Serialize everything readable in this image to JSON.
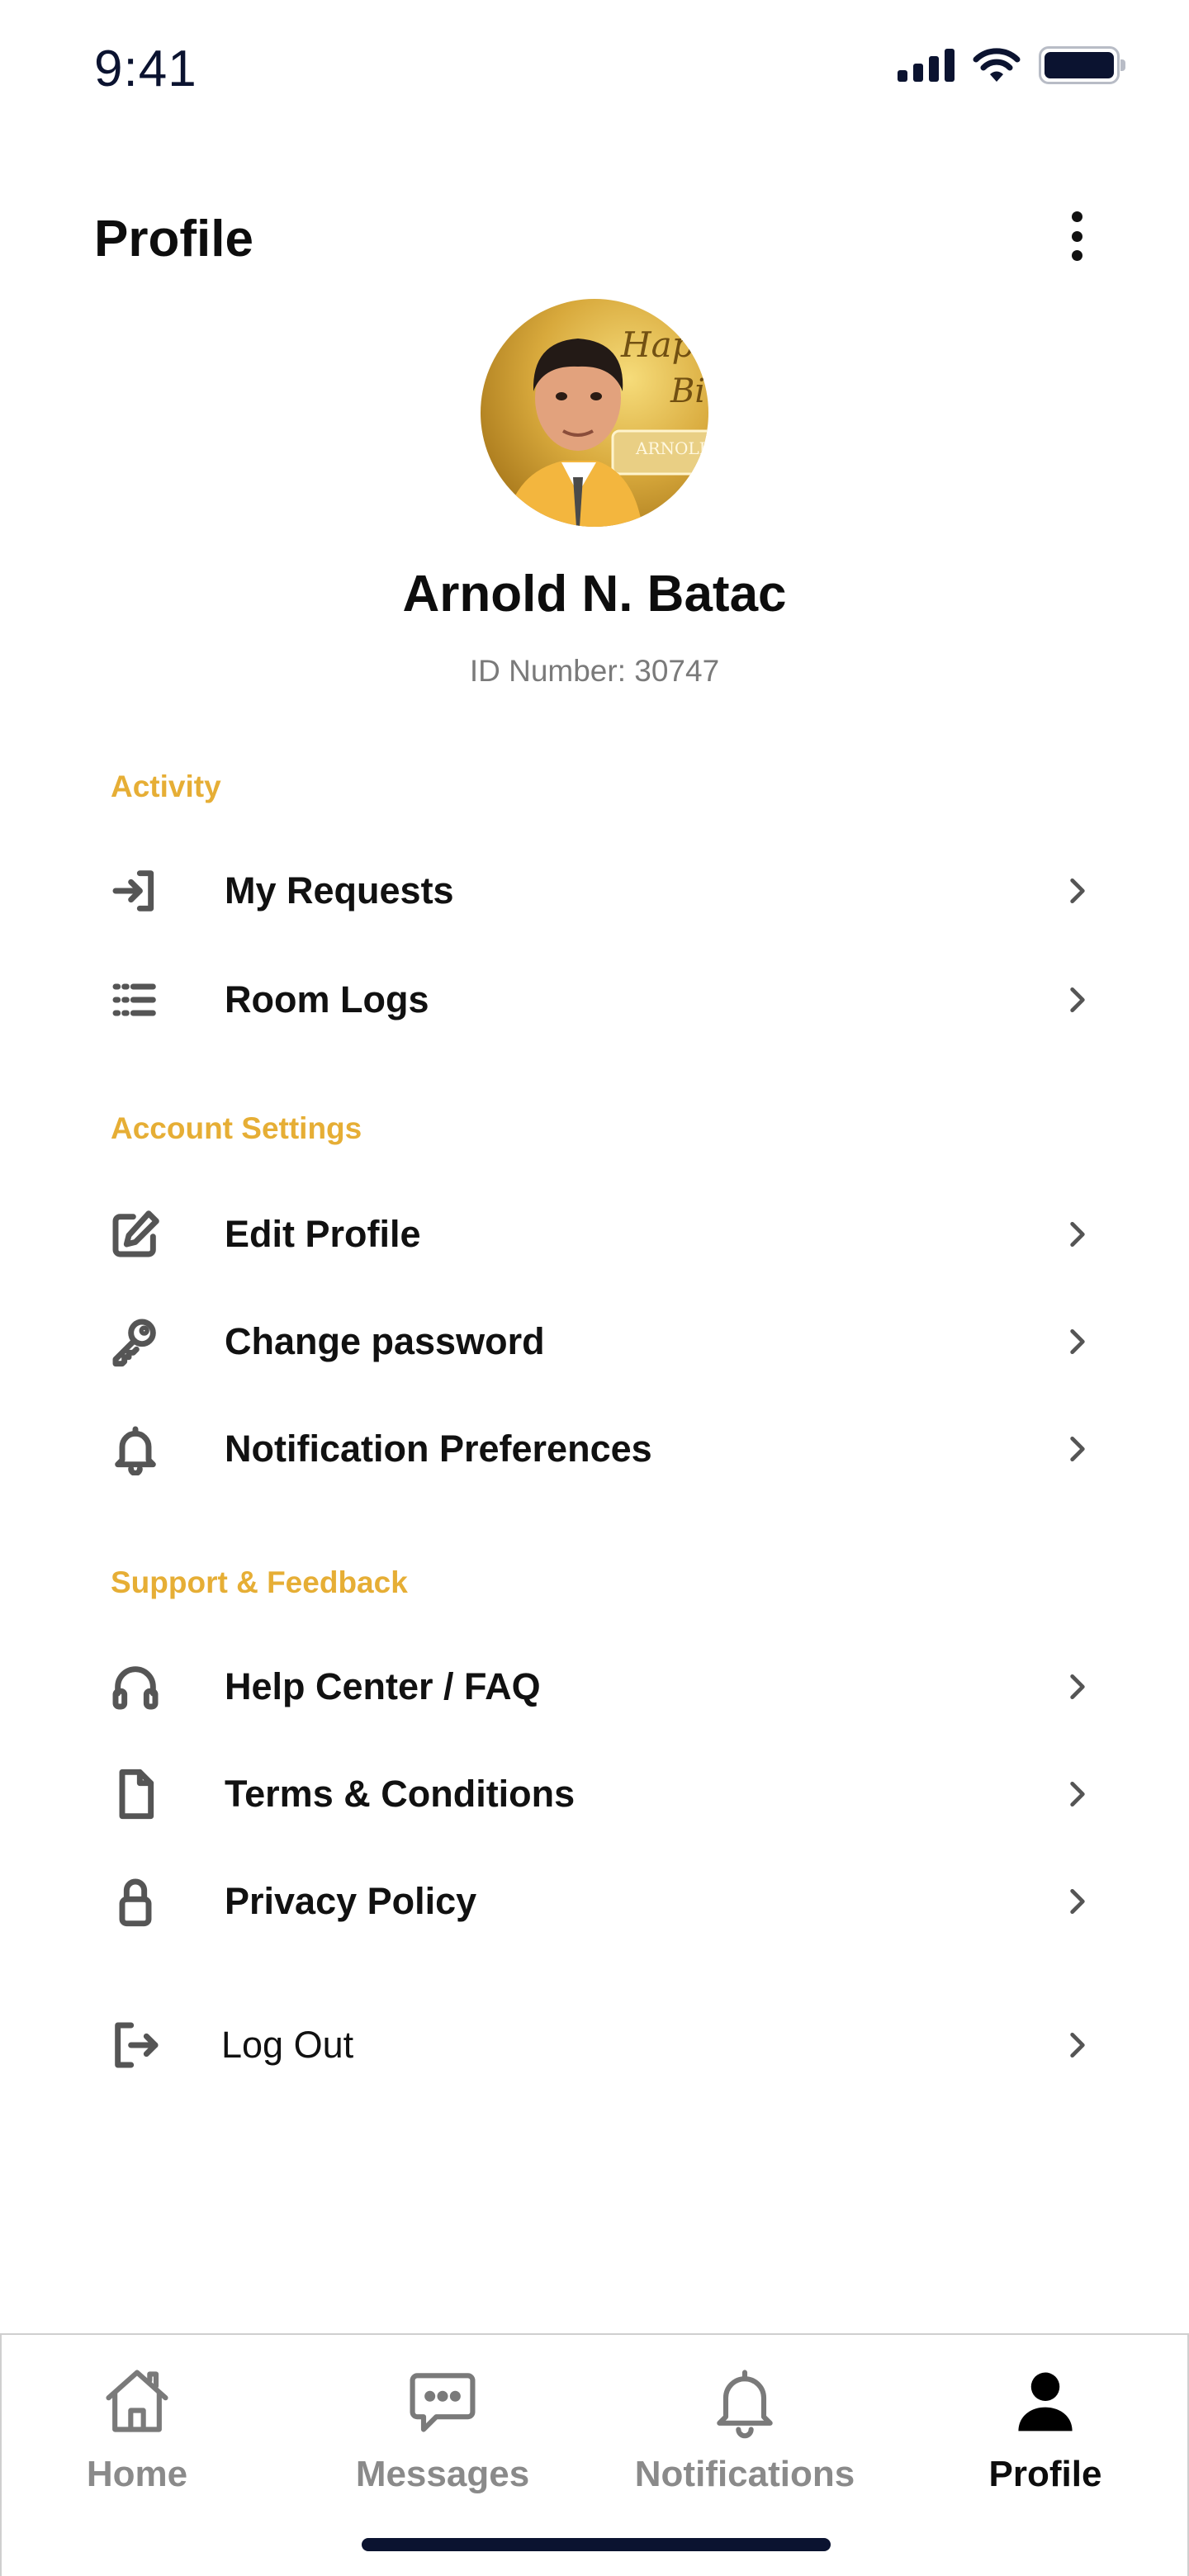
{
  "status_bar": {
    "time": "9:41"
  },
  "header": {
    "title": "Profile"
  },
  "user": {
    "name": "Arnold N. Batac",
    "id_text": "ID Number: 30747",
    "avatar_lettering": "Happy Bi… ARNOLD"
  },
  "sections": {
    "activity": {
      "title": "Activity",
      "items": [
        {
          "label": "My Requests",
          "icon": "sign-in-icon"
        },
        {
          "label": "Room Logs",
          "icon": "list-icon"
        }
      ]
    },
    "account_settings": {
      "title": "Account Settings",
      "items": [
        {
          "label": "Edit Profile",
          "icon": "edit-icon"
        },
        {
          "label": "Change password",
          "icon": "key-icon"
        },
        {
          "label": "Notification Preferences",
          "icon": "bell-icon"
        }
      ]
    },
    "support": {
      "title": "Support & Feedback",
      "items": [
        {
          "label": "Help Center / FAQ",
          "icon": "headphones-icon"
        },
        {
          "label": "Terms & Conditions",
          "icon": "document-icon"
        },
        {
          "label": "Privacy Policy",
          "icon": "lock-icon"
        }
      ]
    },
    "logout": {
      "label": "Log Out",
      "icon": "log-out-icon"
    }
  },
  "bottom_nav": {
    "items": [
      {
        "label": "Home",
        "icon": "home-icon",
        "active": false
      },
      {
        "label": "Messages",
        "icon": "chat-icon",
        "active": false
      },
      {
        "label": "Notifications",
        "icon": "bell-icon",
        "active": false
      },
      {
        "label": "Profile",
        "icon": "user-icon",
        "active": true
      }
    ]
  },
  "colors": {
    "accent": "#E6AE35",
    "text": "#111111",
    "muted": "#8A8A8A",
    "status_dark": "#0B1330"
  }
}
